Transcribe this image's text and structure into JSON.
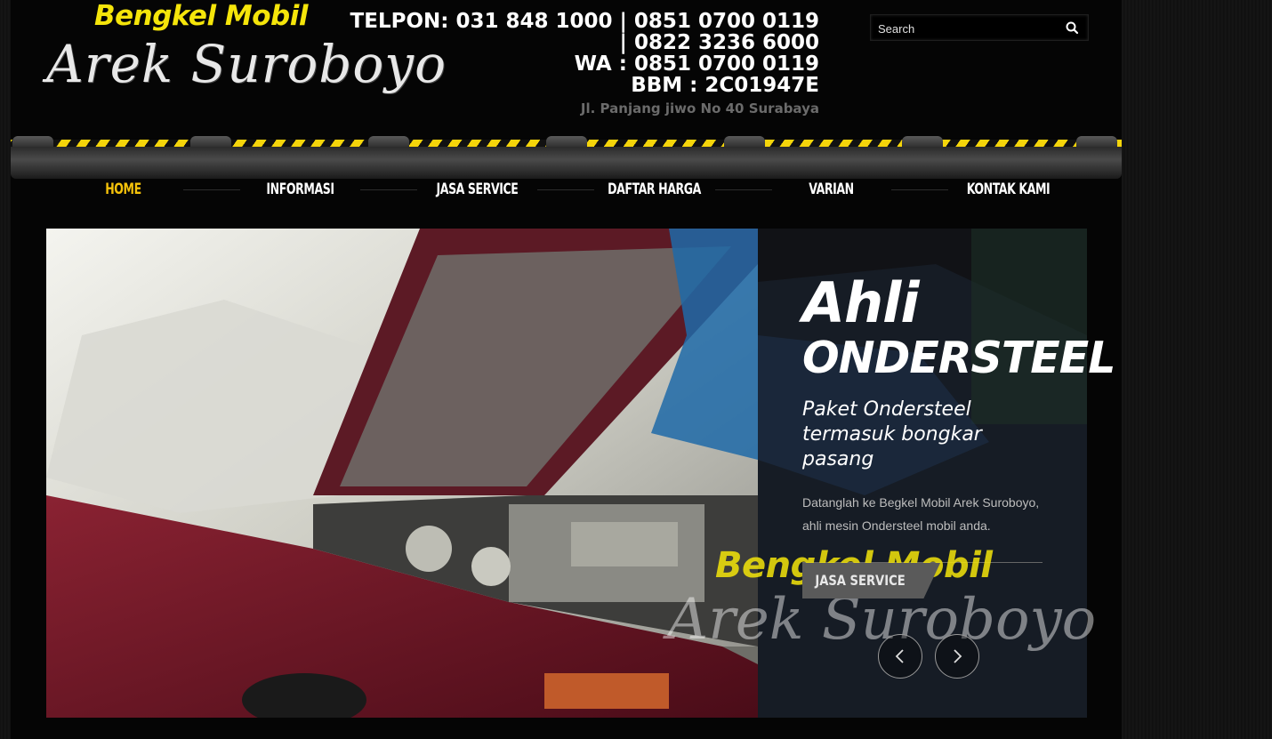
{
  "header": {
    "logo_top": "Bengkel Mobil",
    "logo_bottom": "Arek Suroboyo",
    "contact_lines": [
      "TELPON: 031 848 1000 | 0851 0700 0119",
      "| 0822 3236 6000",
      "WA : 0851 0700 0119",
      "BBM : 2C01947E"
    ],
    "address": "Jl. Panjang jiwo No 40 Surabaya",
    "search_placeholder": "Search",
    "search_icon": "search-icon"
  },
  "nav": {
    "items": [
      {
        "label": "HOME",
        "active": true
      },
      {
        "label": "INFORMASI",
        "active": false
      },
      {
        "label": "JASA SERVICE",
        "active": false
      },
      {
        "label": "DAFTAR HARGA",
        "active": false
      },
      {
        "label": "VARIAN",
        "active": false
      },
      {
        "label": "KONTAK KAMI",
        "active": false
      }
    ],
    "active_color": "#f5c20a"
  },
  "slider": {
    "heading": "Ahli",
    "heading2": "ONDERSTEEL",
    "subheading": "Paket Ondersteel termasuk bongkar pasang",
    "description": "Datanglah ke Begkel Mobil Arek Suroboyo, ahli mesin Ondersteel mobil anda.",
    "button_label": "JASA SERVICE",
    "watermark_top": "Bengkel Mobil",
    "watermark_bottom": "Arek Suroboyo",
    "prev_icon": "chevron-left-icon",
    "next_icon": "chevron-right-icon"
  },
  "colors": {
    "brand_yellow": "#f5e50a",
    "background": "#050505"
  }
}
